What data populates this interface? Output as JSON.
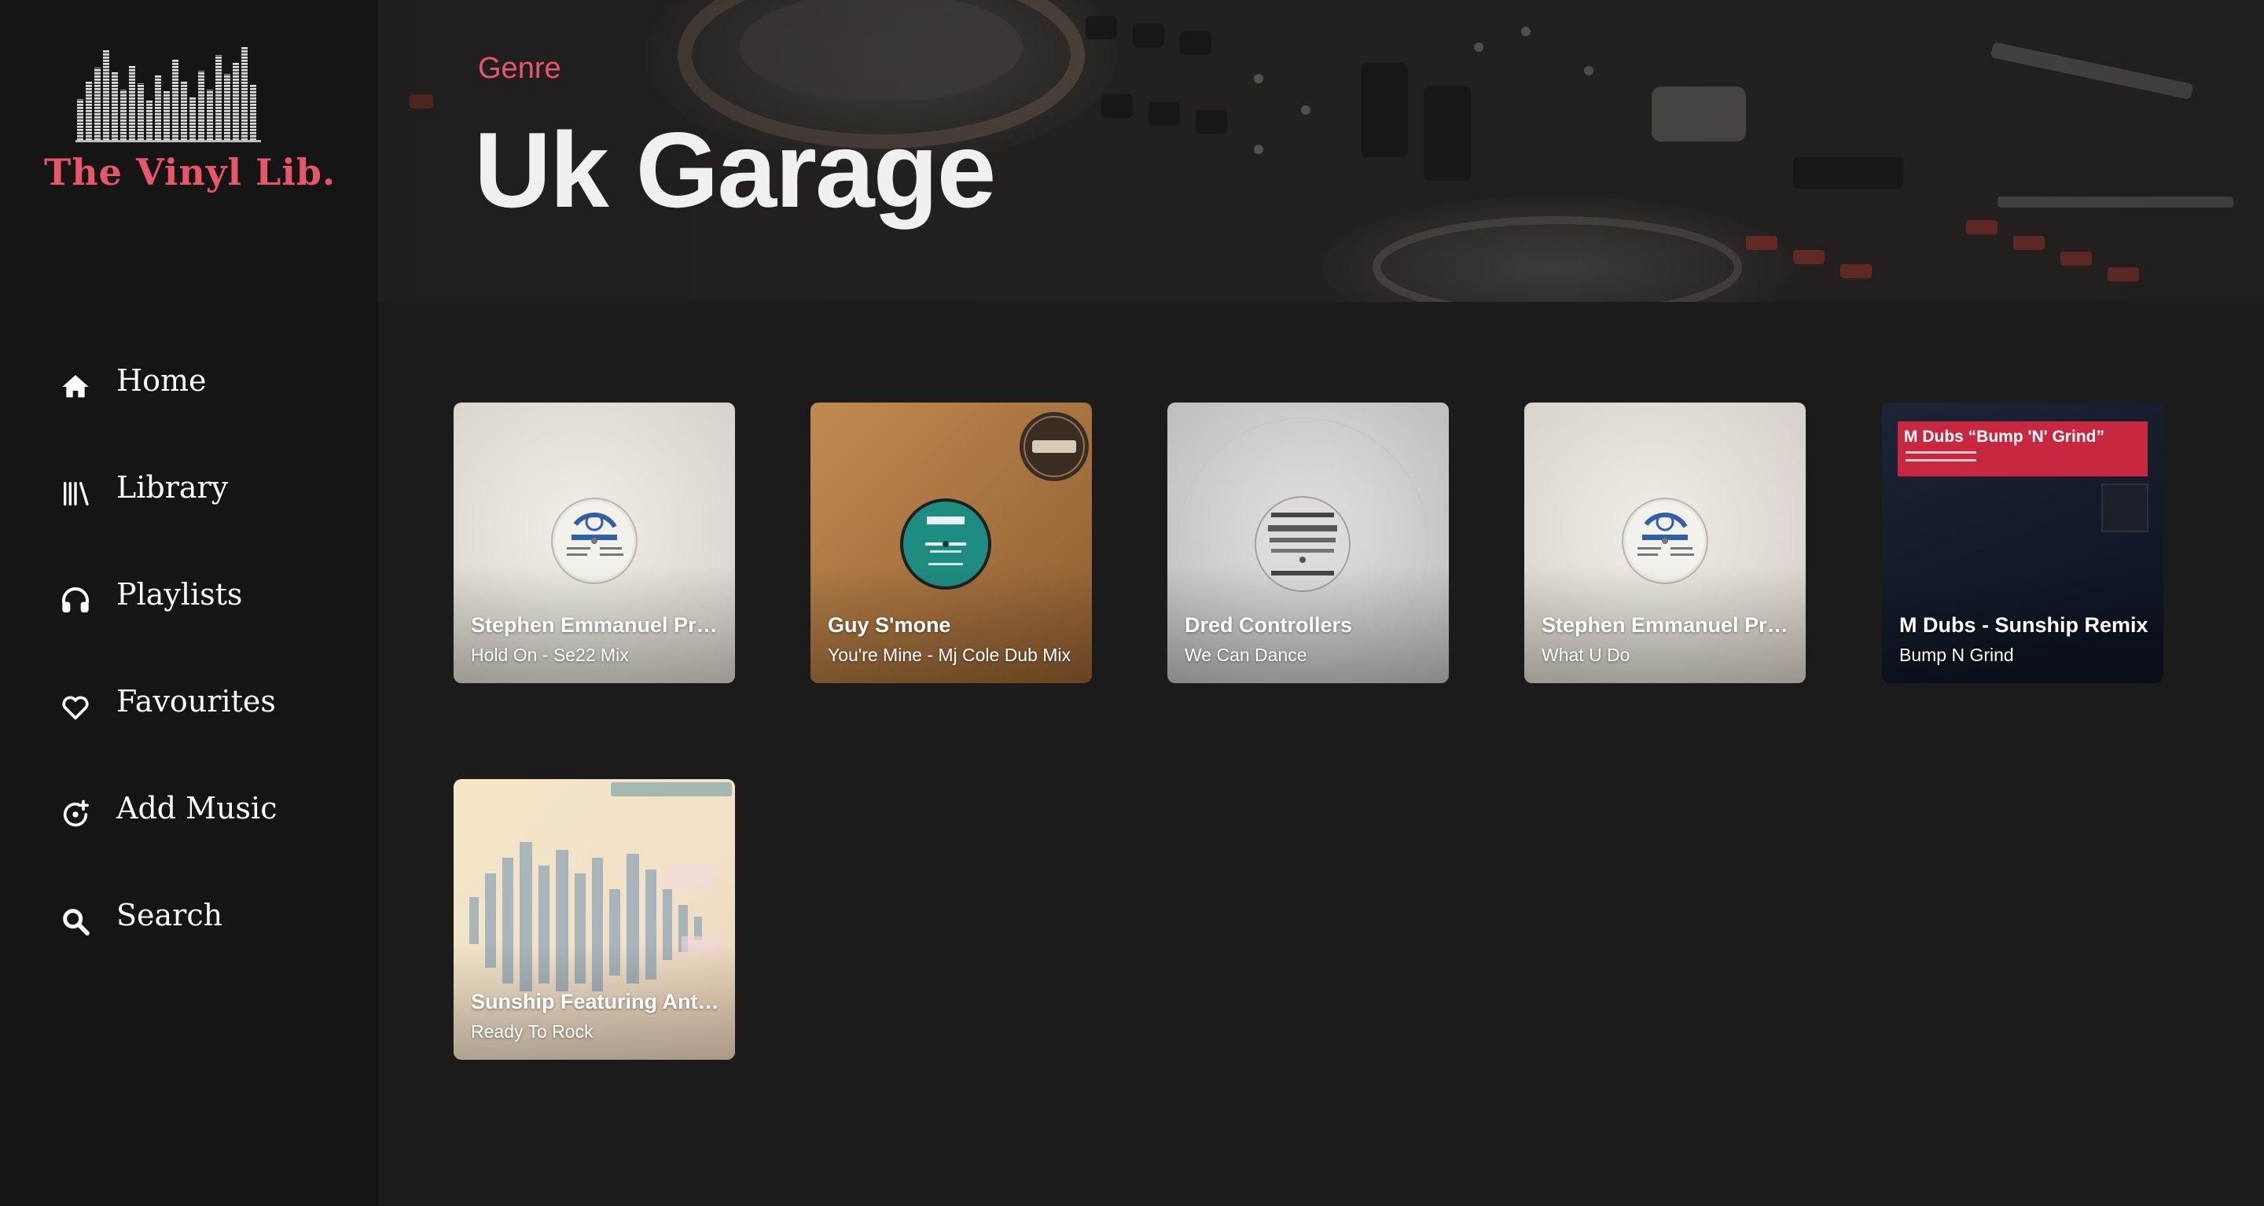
{
  "brand": {
    "name": "The Vinyl Lib.",
    "accent": "#e8566a"
  },
  "sidebar": {
    "items": [
      {
        "label": "Home",
        "icon": "home-icon"
      },
      {
        "label": "Library",
        "icon": "library-icon"
      },
      {
        "label": "Playlists",
        "icon": "headphones-icon"
      },
      {
        "label": "Favourites",
        "icon": "heart-icon"
      },
      {
        "label": "Add Music",
        "icon": "add-music-icon"
      },
      {
        "label": "Search",
        "icon": "search-icon"
      }
    ]
  },
  "header": {
    "eyebrow": "Genre",
    "title": "Uk Garage"
  },
  "records": [
    {
      "artist": "Stephen Emmanuel Presents Colours",
      "title": "Hold On - Se22 Mix",
      "sleeve": "white-label-colours"
    },
    {
      "artist": "Guy S'mone",
      "title": "You're Mine - Mj Cole Dub Mix",
      "sleeve": "brown-prolific"
    },
    {
      "artist": "Dred Controllers",
      "title": "We Can Dance",
      "sleeve": "grey-white-label"
    },
    {
      "artist": "Stephen Emmanuel Presents Colours",
      "title": "What U Do",
      "sleeve": "white-label-colours"
    },
    {
      "artist": "M Dubs - Sunship Remix",
      "title": "Bump N Grind",
      "sleeve": "navy-red-sticker",
      "sleeve_text": "M Dubs “Bump 'N' Grind”"
    },
    {
      "artist": "Sunship Featuring Anthony",
      "title": "Ready To Rock",
      "sleeve": "pastel-waveform"
    }
  ]
}
